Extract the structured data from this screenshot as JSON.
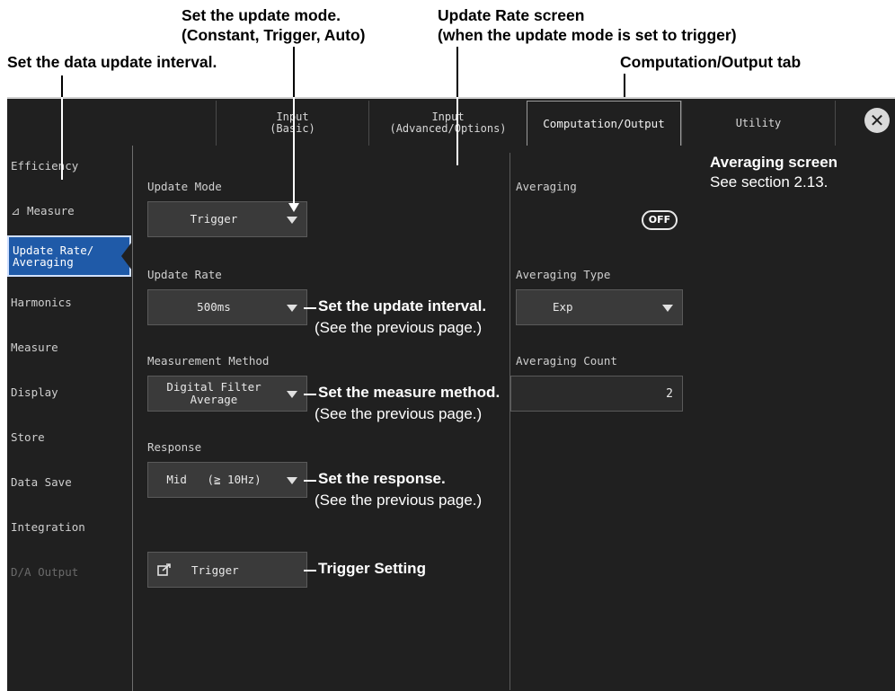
{
  "callouts": {
    "update_mode_line1": "Set the update mode.",
    "update_mode_line2": "(Constant, Trigger, Auto)",
    "update_rate_screen_line1": "Update Rate screen",
    "update_rate_screen_line2": "(when the update mode is set to trigger)",
    "data_update_interval": "Set the data update interval.",
    "comp_output_tab": "Computation/Output tab",
    "averaging_screen_title": "Averaging screen",
    "averaging_screen_ref": "See section 2.13.",
    "update_interval": "Set the update interval.",
    "see_prev_1": "(See the previous page.)",
    "measure_method": "Set the measure method.",
    "see_prev_2": "(See the previous page.)",
    "response": "Set the response.",
    "see_prev_3": "(See the previous page.)",
    "trigger_setting": "Trigger Setting"
  },
  "tabs": [
    {
      "line1": "Input",
      "line2": "(Basic)"
    },
    {
      "line1": "Input",
      "line2": "(Advanced/Options)"
    },
    {
      "label": "Computation/Output"
    },
    {
      "label": "Utility"
    }
  ],
  "close_glyph": "✕",
  "sidebar": {
    "items": [
      {
        "label": "Efficiency"
      },
      {
        "label": "⊿ Measure"
      },
      {
        "line1": "Update Rate/",
        "line2": "Averaging"
      },
      {
        "label": "Harmonics"
      },
      {
        "label": "Measure"
      },
      {
        "label": "Display"
      },
      {
        "label": "Store"
      },
      {
        "label": "Data Save"
      },
      {
        "label": "Integration"
      },
      {
        "label": "D/A Output"
      }
    ]
  },
  "settings": {
    "update_mode_label": "Update Mode",
    "update_mode_value": "Trigger",
    "update_rate_label": "Update Rate",
    "update_rate_value": "500ms",
    "measurement_method_label": "Measurement Method",
    "measurement_method_line1": "Digital Filter",
    "measurement_method_line2": "Average",
    "response_label": "Response",
    "response_value": "Mid   (≧ 10Hz)",
    "trigger_button": "Trigger"
  },
  "averaging": {
    "label": "Averaging",
    "state": "OFF",
    "type_label": "Averaging Type",
    "type_value": "Exp",
    "count_label": "Averaging Count",
    "count_value": "2"
  },
  "colors": {
    "screen_bg": "#202020",
    "active_sidebar": "#1f5aa8",
    "control_bg": "#3a3a3a"
  }
}
